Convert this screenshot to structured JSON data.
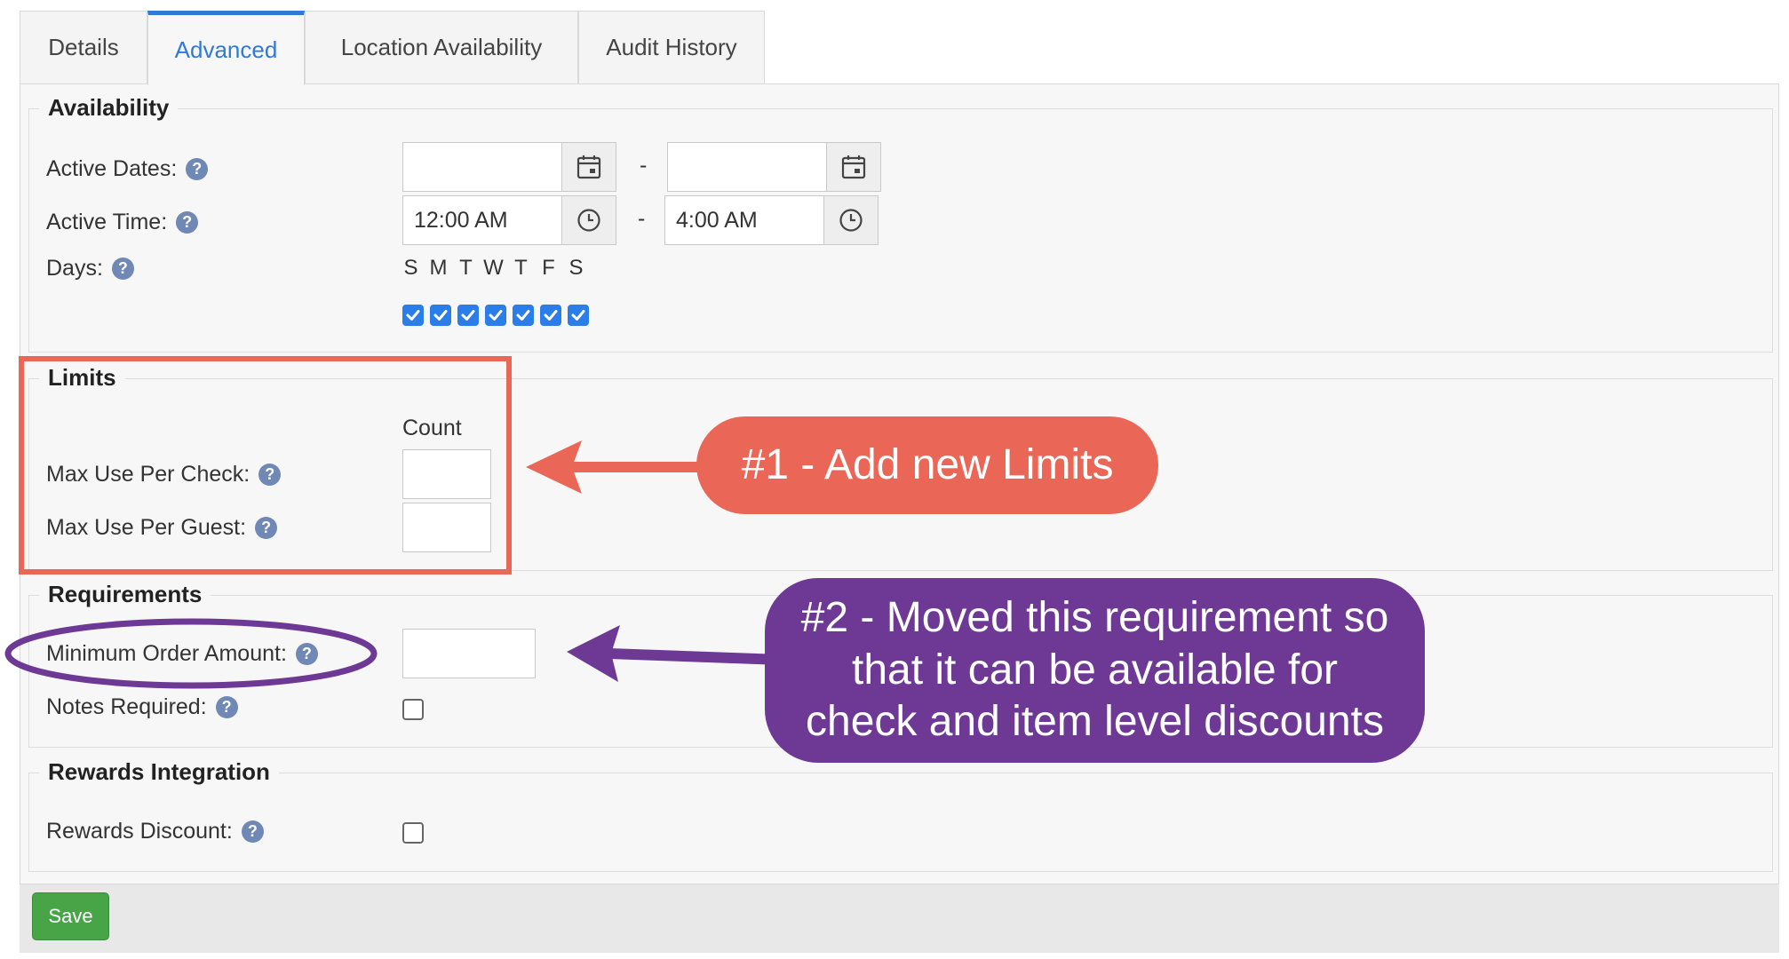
{
  "tabs": [
    "Details",
    "Advanced",
    "Location Availability",
    "Audit History"
  ],
  "active_tab": "Advanced",
  "availability": {
    "legend": "Availability",
    "active_dates_label": "Active Dates:",
    "active_time_label": "Active Time:",
    "days_label": "Days:",
    "start_date": "",
    "end_date": "",
    "start_time": "12:00 AM",
    "end_time": "4:00 AM",
    "separator": "-",
    "day_letters": [
      "S",
      "M",
      "T",
      "W",
      "T",
      "F",
      "S"
    ],
    "days_checked": [
      true,
      true,
      true,
      true,
      true,
      true,
      true
    ]
  },
  "limits": {
    "legend": "Limits",
    "count_header": "Count",
    "max_per_check_label": "Max Use Per Check:",
    "max_per_guest_label": "Max Use Per Guest:"
  },
  "requirements": {
    "legend": "Requirements",
    "min_order_label": "Minimum Order Amount:",
    "notes_required_label": "Notes Required:"
  },
  "rewards": {
    "legend": "Rewards Integration",
    "rewards_discount_label": "Rewards Discount:"
  },
  "footer": {
    "save_label": "Save"
  },
  "annotations": {
    "callout1": "#1 - Add new Limits",
    "callout2_line1": "#2 - Moved this requirement so",
    "callout2_line2": "that it can be available for",
    "callout2_line3": "check and item level discounts",
    "color_red": "#ea6757",
    "color_purple": "#6d3995"
  },
  "colors": {
    "accent": "#2f7ad7",
    "save": "#47a447",
    "help": "#6f88b5"
  },
  "icons": [
    "calendar-icon",
    "clock-icon",
    "help-icon",
    "check-icon"
  ]
}
